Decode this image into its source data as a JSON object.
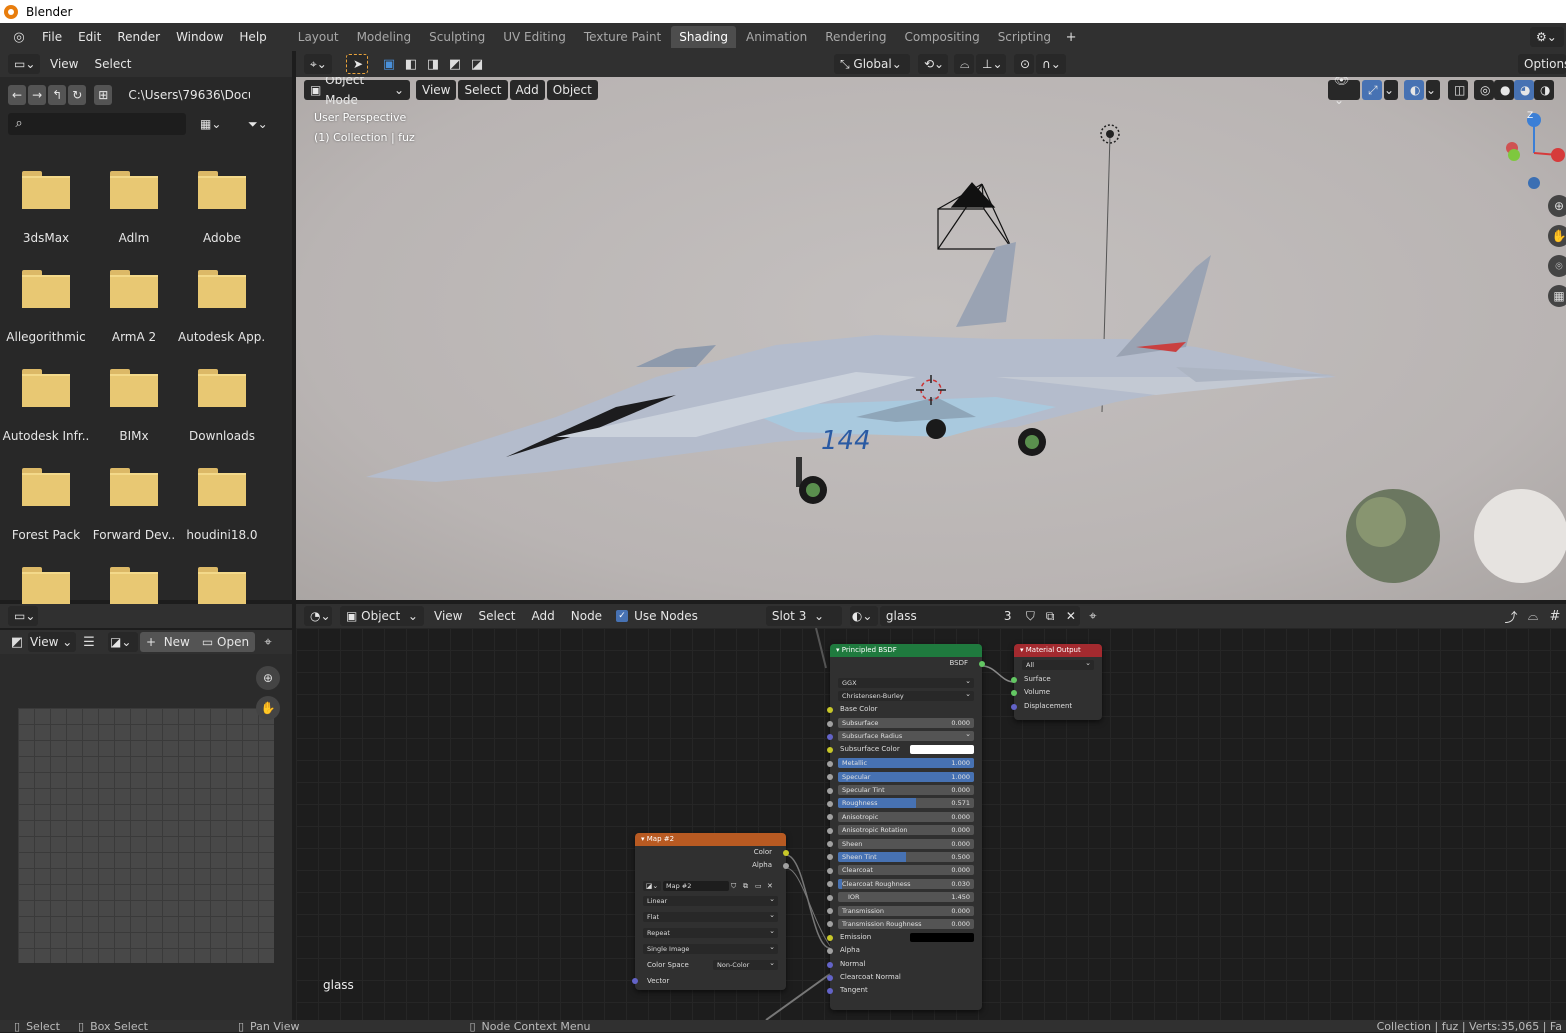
{
  "window_title": "Blender",
  "menu": [
    "File",
    "Edit",
    "Render",
    "Window",
    "Help"
  ],
  "workspaces": [
    "Layout",
    "Modeling",
    "Sculpting",
    "UV Editing",
    "Texture Paint",
    "Shading",
    "Animation",
    "Rendering",
    "Compositing",
    "Scripting"
  ],
  "active_workspace": "Shading",
  "file_browser": {
    "header": {
      "view_label": "View",
      "select_label": "Select"
    },
    "path": "C:\\Users\\79636\\Docu..",
    "search_placeholder": "",
    "folders": [
      "3dsMax",
      "Adlm",
      "Adobe",
      "Allegorithmic",
      "ArmA 2",
      "Autodesk App..",
      "Autodesk Infr..",
      "BIMx",
      "Downloads",
      "Forest Pack",
      "Forward Dev..",
      "houdini18.0",
      "",
      "",
      ""
    ]
  },
  "viewport": {
    "transform_orientation": "Global",
    "options_label": "Options",
    "mode": "Object Mode",
    "menus": [
      "View",
      "Select",
      "Add",
      "Object"
    ],
    "overlay_text_1": "User Perspective",
    "overlay_text_2": "(1) Collection | fuz",
    "aircraft_number": "144"
  },
  "image_editor": {
    "view_label": "View",
    "new_label": "New",
    "open_label": "Open"
  },
  "node_editor": {
    "type": "Object",
    "menus": [
      "View",
      "Select",
      "Add",
      "Node"
    ],
    "use_nodes_label": "Use Nodes",
    "use_nodes_checked": true,
    "slot": "Slot 3",
    "material_name": "glass",
    "material_users": "3",
    "footer_material": "glass",
    "principled": {
      "title": "Principled BSDF",
      "output": "BSDF",
      "distribution": "GGX",
      "subsurface_method": "Christensen-Burley",
      "base_color_label": "Base Color",
      "fields": [
        {
          "label": "Subsurface",
          "value": "0.000",
          "fill": 0
        },
        {
          "label": "Subsurface Radius",
          "value": "",
          "fill": 0,
          "dropdown": true
        },
        {
          "label": "Subsurface Color",
          "value": "",
          "fill": 0,
          "color": "#ffffff"
        },
        {
          "label": "Metallic",
          "value": "1.000",
          "fill": 1
        },
        {
          "label": "Specular",
          "value": "1.000",
          "fill": 1
        },
        {
          "label": "Specular Tint",
          "value": "0.000",
          "fill": 0
        },
        {
          "label": "Roughness",
          "value": "0.571",
          "fill": 0.571
        },
        {
          "label": "Anisotropic",
          "value": "0.000",
          "fill": 0
        },
        {
          "label": "Anisotropic Rotation",
          "value": "0.000",
          "fill": 0
        },
        {
          "label": "Sheen",
          "value": "0.000",
          "fill": 0
        },
        {
          "label": "Sheen Tint",
          "value": "0.500",
          "fill": 0.5
        },
        {
          "label": "Clearcoat",
          "value": "0.000",
          "fill": 0
        },
        {
          "label": "Clearcoat Roughness",
          "value": "0.030",
          "fill": 0.03
        },
        {
          "label": "IOR",
          "value": "1.450",
          "fill": 0
        },
        {
          "label": "Transmission",
          "value": "0.000",
          "fill": 0
        },
        {
          "label": "Transmission Roughness",
          "value": "0.000",
          "fill": 0
        },
        {
          "label": "Emission",
          "value": "",
          "fill": 0,
          "color": "#000000"
        }
      ],
      "inputs_tail": [
        "Alpha",
        "Normal",
        "Clearcoat Normal",
        "Tangent"
      ]
    },
    "material_output": {
      "title": "Material Output",
      "target": "All",
      "inputs": [
        "Surface",
        "Volume",
        "Displacement"
      ]
    },
    "image_node": {
      "title": "Map #2",
      "outputs": [
        "Color",
        "Alpha"
      ],
      "image_name": "Map #2",
      "interpolation": "Linear",
      "projection": "Flat",
      "extension": "Repeat",
      "source": "Single Image",
      "color_space_label": "Color Space",
      "color_space": "Non-Color",
      "vector_label": "Vector"
    }
  },
  "status_bar": {
    "select": "Select",
    "box_select": "Box Select",
    "pan_view": "Pan View",
    "node_context": "Node Context Menu",
    "stats": "Collection | fuz | Verts:35,065 | Fa"
  },
  "colors": {
    "accent_blue": "#4772b3",
    "header_bg": "#303030",
    "principled_header": "#1f7a3e",
    "output_header": "#a32a2f",
    "image_header": "#b85a22"
  }
}
